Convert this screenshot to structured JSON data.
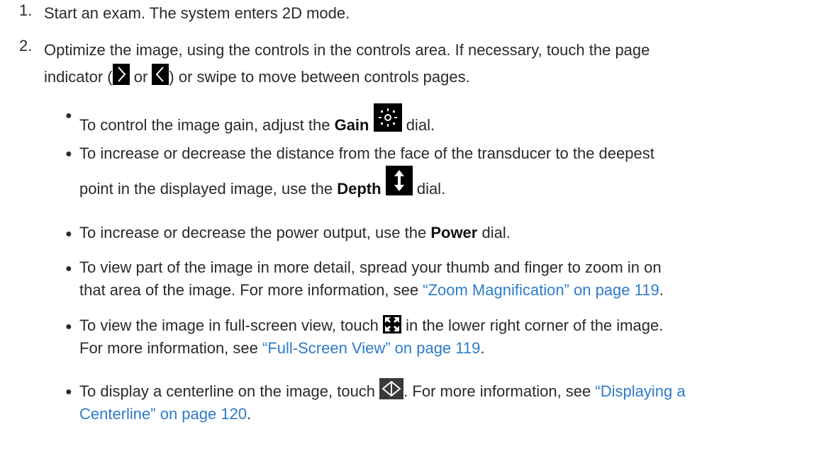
{
  "steps": [
    {
      "number": "1.",
      "text": "Start an exam. The system enters 2D mode."
    },
    {
      "number": "2.",
      "text_a": "Optimize the image, using the controls in the controls area. If necessary, touch the page",
      "text_b": "indicator (",
      "text_or": "or",
      "text_c": ") or swipe to move between controls pages."
    }
  ],
  "bullets": {
    "gain": {
      "pre": "To control the image gain, adjust the",
      "bold": "Gain",
      "post": "dial."
    },
    "depth": {
      "line1": "To increase or decrease the distance from the face of the transducer to the deepest",
      "pre": "point in the displayed image, use the",
      "bold": "Depth",
      "post": "dial."
    },
    "power": {
      "pre": "To increase or decrease the power output, use the",
      "bold": "Power",
      "post": "dial."
    },
    "zoom": {
      "line1": "To view part of the image in more detail, spread your thumb and finger to zoom in on",
      "pre": "that area of the image. For more information, see",
      "link": "“Zoom Magnification” on page 119",
      "post": "."
    },
    "fullscreen": {
      "pre": "To view the image in full-screen view, touch",
      "post": "in the lower right corner of the image.",
      "line2_pre": "For more information, see",
      "link": "“Full-Screen View” on page 119",
      "line2_post": "."
    },
    "centerline": {
      "pre": "To display a centerline on the image, touch",
      "mid": ". For more information, see",
      "link_a": "“Displaying a",
      "link_b": "Centerline” on page 120",
      "post": "."
    }
  },
  "icons": [
    "chevron-right-icon",
    "chevron-left-icon",
    "gain-icon",
    "depth-icon",
    "fullscreen-icon",
    "centerline-icon"
  ],
  "colors": {
    "link": "#2e7cc8",
    "text": "#2a2a2a",
    "icon_bg": "#000000"
  }
}
